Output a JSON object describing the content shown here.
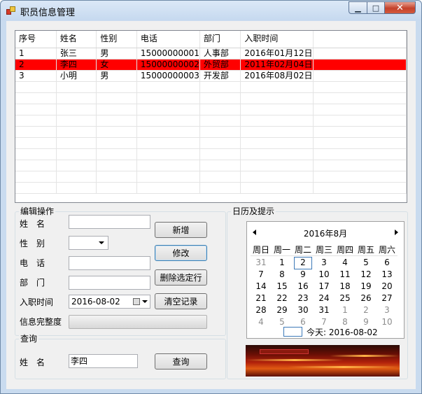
{
  "window": {
    "title": "职员信息管理",
    "close_glyph": "✕",
    "min_glyph": "▁",
    "max_glyph": "□"
  },
  "grid": {
    "columns": [
      "序号",
      "姓名",
      "性别",
      "电话",
      "部门",
      "入职时间"
    ],
    "rows": [
      [
        "1",
        "张三",
        "男",
        "15000000001",
        "人事部",
        "2016年01月12日"
      ],
      [
        "2",
        "李四",
        "女",
        "15000000002",
        "外贸部",
        "2011年02月04日"
      ],
      [
        "3",
        "小明",
        "男",
        "15000000003",
        "开发部",
        "2016年08月02日"
      ]
    ],
    "selected_row": 1,
    "highlight_color": "#ff0000"
  },
  "edit": {
    "group_title": "编辑操作",
    "name_label": "姓　名",
    "gender_label": "性　别",
    "phone_label": "电　话",
    "dept_label": "部　门",
    "hire_label": "入职时间",
    "complete_label": "信息完整度",
    "name_value": "",
    "gender_value": "",
    "phone_value": "",
    "dept_value": "",
    "hire_value": "2016-08-02",
    "completeness": 0,
    "buttons": {
      "add": "新增",
      "modify": "修改",
      "delete": "删除选定行",
      "clear": "清空记录"
    }
  },
  "query": {
    "group_title": "查询",
    "name_label": "姓　名",
    "name_value": "李四",
    "button": "查询"
  },
  "calendar": {
    "group_title": "日历及提示",
    "month_title": "2016年8月",
    "weekdays": [
      "周日",
      "周一",
      "周二",
      "周三",
      "周四",
      "周五",
      "周六"
    ],
    "weeks": [
      [
        [
          "31",
          1
        ],
        [
          "1",
          0
        ],
        [
          "2",
          0
        ],
        [
          "3",
          0
        ],
        [
          "4",
          0
        ],
        [
          "5",
          0
        ],
        [
          "6",
          0
        ]
      ],
      [
        [
          "7",
          0
        ],
        [
          "8",
          0
        ],
        [
          "9",
          0
        ],
        [
          "10",
          0
        ],
        [
          "11",
          0
        ],
        [
          "12",
          0
        ],
        [
          "13",
          0
        ]
      ],
      [
        [
          "14",
          0
        ],
        [
          "15",
          0
        ],
        [
          "16",
          0
        ],
        [
          "17",
          0
        ],
        [
          "18",
          0
        ],
        [
          "19",
          0
        ],
        [
          "20",
          0
        ]
      ],
      [
        [
          "21",
          0
        ],
        [
          "22",
          0
        ],
        [
          "23",
          0
        ],
        [
          "24",
          0
        ],
        [
          "25",
          0
        ],
        [
          "26",
          0
        ],
        [
          "27",
          0
        ]
      ],
      [
        [
          "28",
          0
        ],
        [
          "29",
          0
        ],
        [
          "30",
          0
        ],
        [
          "31",
          0
        ],
        [
          "1",
          1
        ],
        [
          "2",
          1
        ],
        [
          "3",
          1
        ]
      ],
      [
        [
          "4",
          1
        ],
        [
          "5",
          1
        ],
        [
          "6",
          1
        ],
        [
          "7",
          1
        ],
        [
          "8",
          1
        ],
        [
          "9",
          1
        ],
        [
          "10",
          1
        ]
      ]
    ],
    "today_day": "2",
    "today_text": "今天: 2016-08-02"
  }
}
